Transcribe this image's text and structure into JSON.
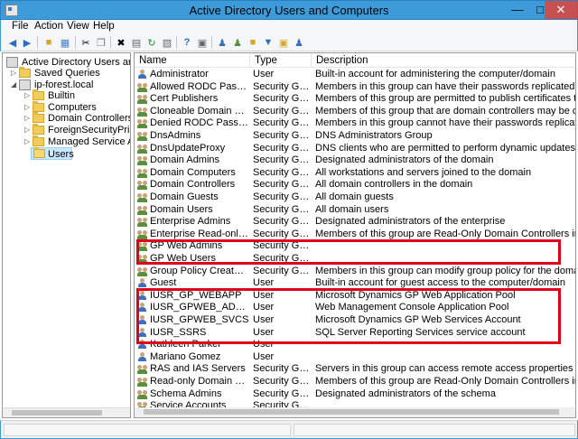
{
  "window": {
    "title": "Active Directory Users and Computers"
  },
  "menu": [
    "File",
    "Action",
    "View",
    "Help"
  ],
  "tree": [
    {
      "label": "Active Directory Users and Com",
      "icon": "ad-console-icon",
      "indent": 0
    },
    {
      "label": "Saved Queries",
      "icon": "folder-icon",
      "indent": 1,
      "expander": "collapsed"
    },
    {
      "label": "ip-forest.local",
      "icon": "domain-icon",
      "indent": 1,
      "expander": "expanded"
    },
    {
      "label": "Builtin",
      "icon": "folder-icon",
      "indent": 2,
      "expander": "collapsed"
    },
    {
      "label": "Computers",
      "icon": "folder-icon",
      "indent": 2,
      "expander": "collapsed"
    },
    {
      "label": "Domain Controllers",
      "icon": "ou-icon",
      "indent": 2,
      "expander": "collapsed"
    },
    {
      "label": "ForeignSecurityPrincipals",
      "icon": "folder-icon",
      "indent": 2,
      "expander": "collapsed"
    },
    {
      "label": "Managed Service Accoun",
      "icon": "folder-icon",
      "indent": 2,
      "expander": "collapsed"
    },
    {
      "label": "Users",
      "icon": "folder-open-icon",
      "indent": 2,
      "selected": true
    }
  ],
  "columns": [
    "Name",
    "Type",
    "Description"
  ],
  "rows": [
    {
      "name": "Administrator",
      "type": "User",
      "desc": "Built-in account for administering the computer/domain",
      "kind": "user"
    },
    {
      "name": "Allowed RODC Password R...",
      "type": "Security Group...",
      "desc": "Members in this group can have their passwords replicated to all read-o",
      "kind": "group"
    },
    {
      "name": "Cert Publishers",
      "type": "Security Group...",
      "desc": "Members of this group are permitted to publish certificates to the director",
      "kind": "group"
    },
    {
      "name": "Cloneable Domain Control...",
      "type": "Security Group...",
      "desc": "Members of this group that are domain controllers may be cloned.",
      "kind": "group"
    },
    {
      "name": "Denied RODC Password Re...",
      "type": "Security Group...",
      "desc": "Members in this group cannot have their passwords replicated to any re",
      "kind": "group"
    },
    {
      "name": "DnsAdmins",
      "type": "Security Group...",
      "desc": "DNS Administrators Group",
      "kind": "group"
    },
    {
      "name": "DnsUpdateProxy",
      "type": "Security Group...",
      "desc": "DNS clients who are permitted to perform dynamic updates on behalf o",
      "kind": "group"
    },
    {
      "name": "Domain Admins",
      "type": "Security Group...",
      "desc": "Designated administrators of the domain",
      "kind": "group"
    },
    {
      "name": "Domain Computers",
      "type": "Security Group...",
      "desc": "All workstations and servers joined to the domain",
      "kind": "group"
    },
    {
      "name": "Domain Controllers",
      "type": "Security Group...",
      "desc": "All domain controllers in the domain",
      "kind": "group"
    },
    {
      "name": "Domain Guests",
      "type": "Security Group...",
      "desc": "All domain guests",
      "kind": "group"
    },
    {
      "name": "Domain Users",
      "type": "Security Group...",
      "desc": "All domain users",
      "kind": "group"
    },
    {
      "name": "Enterprise Admins",
      "type": "Security Group...",
      "desc": "Designated administrators of the enterprise",
      "kind": "group"
    },
    {
      "name": "Enterprise Read-only Doma...",
      "type": "Security Group...",
      "desc": "Members of this group are Read-Only Domain Controllers in the enterpris",
      "kind": "group"
    },
    {
      "name": "GP Web Admins",
      "type": "Security Group...",
      "desc": "",
      "kind": "group"
    },
    {
      "name": "GP Web Users",
      "type": "Security Group...",
      "desc": "",
      "kind": "group"
    },
    {
      "name": "Group Policy Creator Own...",
      "type": "Security Group...",
      "desc": "Members in this group can modify group policy for the domain",
      "kind": "group"
    },
    {
      "name": "Guest",
      "type": "User",
      "desc": "Built-in account for guest access to the computer/domain",
      "kind": "user"
    },
    {
      "name": "IUSR_GP_WEBAPP",
      "type": "User",
      "desc": "Microsoft Dynamics GP Web Application Pool",
      "kind": "user"
    },
    {
      "name": "IUSR_GPWEB_ADMIN",
      "type": "User",
      "desc": "Web Management Console Application Pool",
      "kind": "user"
    },
    {
      "name": "IUSR_GPWEB_SVCS",
      "type": "User",
      "desc": "Microsoft Dynamics GP Web Services Account",
      "kind": "user"
    },
    {
      "name": "IUSR_SSRS",
      "type": "User",
      "desc": "SQL Server Reporting Services service account",
      "kind": "user"
    },
    {
      "name": "Kathleen Parker",
      "type": "User",
      "desc": "",
      "kind": "user"
    },
    {
      "name": "Mariano Gomez",
      "type": "User",
      "desc": "",
      "kind": "user"
    },
    {
      "name": "RAS and IAS Servers",
      "type": "Security Group...",
      "desc": "Servers in this group can access remote access properties of users",
      "kind": "group"
    },
    {
      "name": "Read-only Domain Control...",
      "type": "Security Group...",
      "desc": "Members of this group are Read-Only Domain Controllers in the domain",
      "kind": "group"
    },
    {
      "name": "Schema Admins",
      "type": "Security Group...",
      "desc": "Designated administrators of the schema",
      "kind": "group"
    },
    {
      "name": "Service Accounts",
      "type": "Security Group...",
      "desc": "",
      "kind": "group"
    }
  ],
  "highlight_color": "#e0001b"
}
